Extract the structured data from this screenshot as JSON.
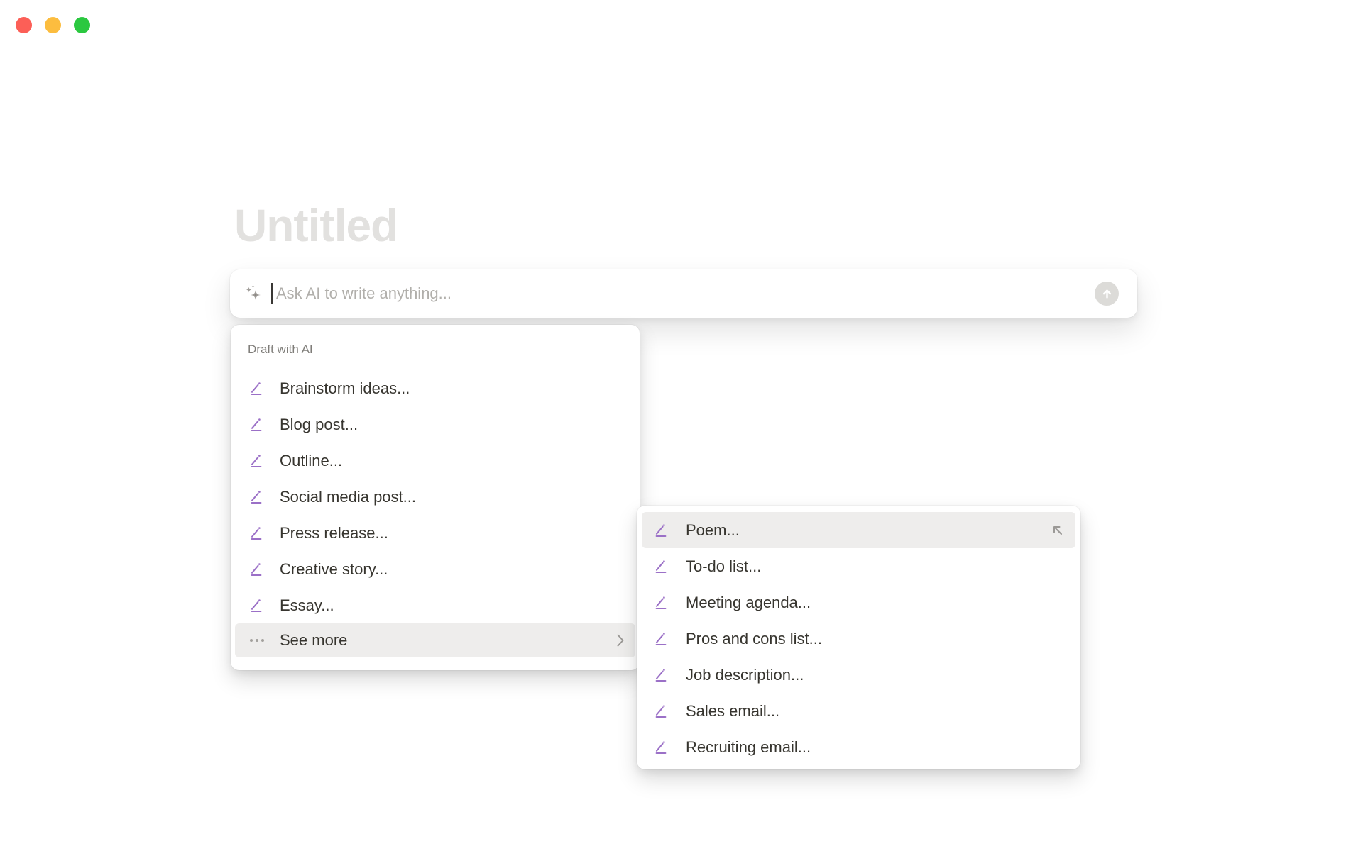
{
  "window": {
    "controls": [
      {
        "name": "close"
      },
      {
        "name": "minimize"
      },
      {
        "name": "zoom"
      }
    ]
  },
  "page": {
    "title_placeholder": "Untitled"
  },
  "ai_input": {
    "placeholder": "Ask AI to write anything...",
    "icons": {
      "left": "sparkle-icon",
      "submit": "arrow-up-icon"
    }
  },
  "draft_menu": {
    "header": "Draft with AI",
    "items": [
      {
        "label": "Brainstorm ideas..."
      },
      {
        "label": "Blog post..."
      },
      {
        "label": "Outline..."
      },
      {
        "label": "Social media post..."
      },
      {
        "label": "Press release..."
      },
      {
        "label": "Creative story..."
      },
      {
        "label": "Essay..."
      }
    ],
    "see_more": {
      "label": "See more",
      "icon": "ellipsis-icon",
      "chevron": "chevron-right-icon"
    }
  },
  "see_more_submenu": {
    "items": [
      {
        "label": "Poem...",
        "selected": true,
        "trailing_icon": "arrow-up-left-icon"
      },
      {
        "label": "To-do list..."
      },
      {
        "label": "Meeting agenda..."
      },
      {
        "label": "Pros and cons list..."
      },
      {
        "label": "Job description..."
      },
      {
        "label": "Sales email..."
      },
      {
        "label": "Recruiting email..."
      }
    ]
  },
  "colors": {
    "accent_purple": "#9b70c7",
    "item_text": "#37352f",
    "muted_text": "#7f7d79",
    "placeholder_text": "#b1afab",
    "title_placeholder": "#e2e1df",
    "hover_background": "#eeedec",
    "traffic_red": "#fc5f57",
    "traffic_yellow": "#fcbd3f",
    "traffic_green": "#2bc840"
  }
}
